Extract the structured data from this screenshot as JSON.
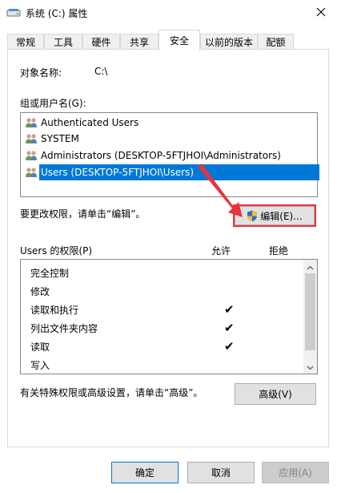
{
  "window": {
    "title": "系统 (C:) 属性",
    "icon": "drive-icon"
  },
  "tabs": [
    {
      "label": "常规"
    },
    {
      "label": "工具"
    },
    {
      "label": "硬件"
    },
    {
      "label": "共享"
    },
    {
      "label": "安全"
    },
    {
      "label": "以前的版本"
    },
    {
      "label": "配额"
    }
  ],
  "active_tab": "安全",
  "object": {
    "label": "对象名称:",
    "value": "C:\\"
  },
  "groups": {
    "label": "组或用户名(G):",
    "items": [
      {
        "name": "Authenticated Users"
      },
      {
        "name": "SYSTEM"
      },
      {
        "name": "Administrators (DESKTOP-5FTJHOI\\Administrators)"
      },
      {
        "name": "Users (DESKTOP-5FTJHOI\\Users)"
      }
    ],
    "selected": "Users (DESKTOP-5FTJHOI\\Users)"
  },
  "edit": {
    "hint": "要更改权限，请单击“编辑”。",
    "button_label": "编辑(E)..."
  },
  "permissions": {
    "label": "Users 的权限(P)",
    "allow_header": "允许",
    "deny_header": "拒绝",
    "rows": [
      {
        "name": "完全控制",
        "allow": "",
        "deny": ""
      },
      {
        "name": "修改",
        "allow": "",
        "deny": ""
      },
      {
        "name": "读取和执行",
        "allow": "✔",
        "deny": ""
      },
      {
        "name": "列出文件夹内容",
        "allow": "✔",
        "deny": ""
      },
      {
        "name": "读取",
        "allow": "✔",
        "deny": ""
      },
      {
        "name": "写入",
        "allow": "",
        "deny": ""
      }
    ]
  },
  "advanced": {
    "hint": "有关特殊权限或高级设置，请单击“高级”。",
    "button_label": "高级(V)"
  },
  "footer": {
    "ok_label": "确定",
    "cancel_label": "取消",
    "apply_label": "应用(A)"
  },
  "colors": {
    "selection": "#0078d7",
    "annotation": "#e8333b"
  }
}
